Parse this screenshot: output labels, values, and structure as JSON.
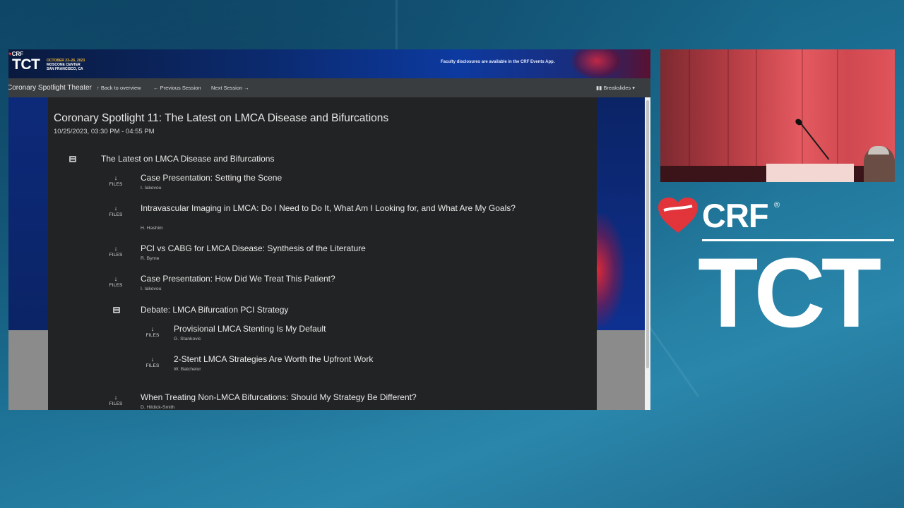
{
  "banner": {
    "crf_logo": "CRF",
    "tct_logo": "TCT",
    "event_dates": "OCTOBER 23–26, 2023",
    "event_venue": "MOSCONE CENTER",
    "event_city": "SAN FRANCISCO, CA",
    "notice": "Faculty disclosures are available in the CRF Events App."
  },
  "navbar": {
    "title": "Coronary Spotlight Theater",
    "back_to_overview": "Back to overview",
    "previous_session": "Previous Session",
    "next_session": "Next Session",
    "breakslides": "Breakslides",
    "up_arrow": "↑",
    "left_arrow": "←",
    "right_arrow": "→",
    "caret": "▾"
  },
  "session": {
    "title": "Coronary Spotlight 11: The Latest on LMCA Disease and Bifurcations",
    "time": "10/25/2023, 03:30 PM - 04:55 PM",
    "group_title": "The Latest on LMCA Disease and Bifurcations",
    "files_label": "FILES",
    "download_arrow": "↓",
    "talks": [
      {
        "title": "Case Presentation: Setting the Scene",
        "speaker": "I. Iakovou"
      },
      {
        "title": "Intravascular Imaging in LMCA: Do I Need to Do It, What Am I Looking for, and What Are My Goals?",
        "speaker": "H. Hashim"
      },
      {
        "title": "PCI vs CABG for LMCA Disease: Synthesis of the Literature",
        "speaker": "R. Byrne"
      },
      {
        "title": "Case Presentation: How Did We Treat This Patient?",
        "speaker": "I. Iakovou"
      }
    ],
    "debate": {
      "title": "Debate: LMCA Bifurcation PCI Strategy",
      "talks": [
        {
          "title": "Provisional LMCA Stenting Is My Default",
          "speaker": "G. Stankovic"
        },
        {
          "title": "2-Stent LMCA Strategies Are Worth the Upfront Work",
          "speaker": "W. Batchelor"
        }
      ]
    },
    "last_talk": {
      "title": "When Treating Non-LMCA Bifurcations: Should My Strategy Be Different?",
      "speaker": "D. Hildick-Smith"
    }
  },
  "branding": {
    "crf": "CRF",
    "registered": "®",
    "tct": "TCT"
  },
  "colors": {
    "background": "#1b6f92",
    "content_bg": "#222324",
    "navbar_bg": "#3a3d40",
    "crf_red": "#e2343b"
  }
}
